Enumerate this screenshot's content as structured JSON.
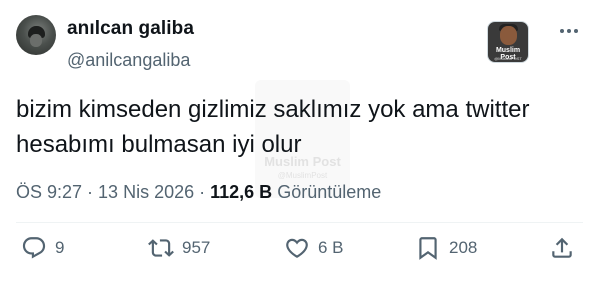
{
  "author": {
    "name": "anılcan galiba",
    "handle": "@anilcangaliba"
  },
  "badge": {
    "label": "Muslim Post",
    "sublabel": "@MuslimPOST"
  },
  "tweet": {
    "text_line1": "bizim kimseden gizlimiz saklımız yok ama twitter",
    "text_line2": "hesabımı bulmasan iyi olur"
  },
  "watermark": {
    "label": "Muslim Post",
    "sublabel": "@MuslimPost"
  },
  "meta": {
    "time": "ÖS 9:27",
    "separator": "·",
    "date": "13 Nis 2026",
    "views_count": "112,6 B",
    "views_label": "Görüntüleme"
  },
  "actions": {
    "replies": "9",
    "retweets": "957",
    "likes": "6 B",
    "bookmarks": "208"
  },
  "icons": [
    "avatar",
    "more-icon",
    "reply-icon",
    "retweet-icon",
    "like-icon",
    "bookmark-icon",
    "share-icon"
  ]
}
